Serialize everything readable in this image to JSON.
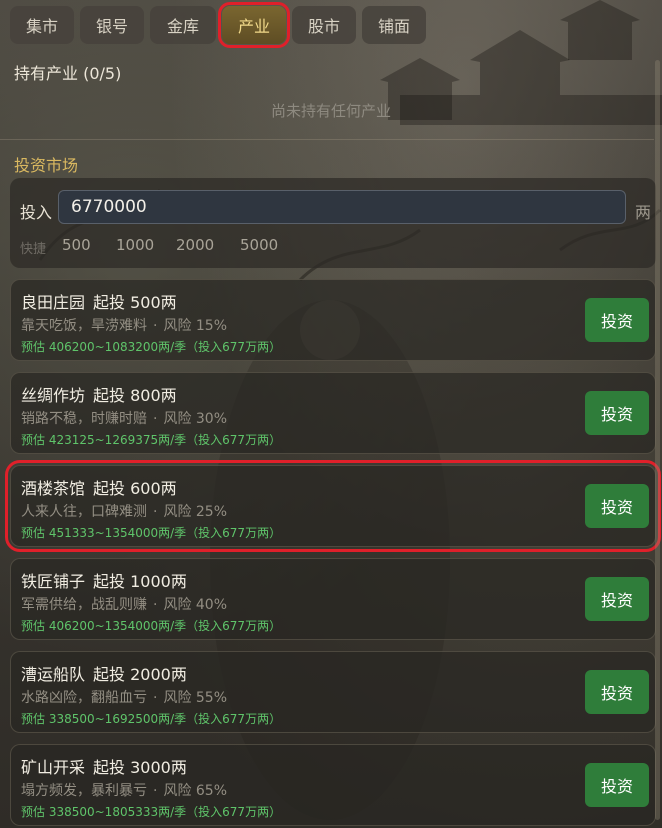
{
  "tabs": [
    {
      "label": "集市"
    },
    {
      "label": "银号"
    },
    {
      "label": "金库"
    },
    {
      "label": "产业",
      "active": true
    },
    {
      "label": "股市"
    },
    {
      "label": "铺面"
    }
  ],
  "holdings": {
    "title": "持有产业 (0/5)",
    "empty_text": "尚未持有任何产业"
  },
  "market": {
    "title": "投资市场",
    "invest_label": "投入",
    "invest_value": "6770000",
    "unit": "两",
    "quick_label": "快捷",
    "quick_amounts": [
      "500",
      "1000",
      "2000",
      "5000"
    ]
  },
  "industries": [
    {
      "name": "良田庄园",
      "min": "起投 500两",
      "desc": "靠天吃饭，旱涝难料",
      "risk": "风险 15%",
      "estimate": "预估 406200~1083200两/季（投入677万两）",
      "button": "投资"
    },
    {
      "name": "丝绸作坊",
      "min": "起投 800两",
      "desc": "销路不稳，时赚时赔",
      "risk": "风险 30%",
      "estimate": "预估 423125~1269375两/季（投入677万两）",
      "button": "投资"
    },
    {
      "name": "酒楼茶馆",
      "min": "起投 600两",
      "desc": "人来人往，口碑难测",
      "risk": "风险 25%",
      "estimate": "预估 451333~1354000两/季（投入677万两）",
      "button": "投资",
      "highlight": true
    },
    {
      "name": "铁匠铺子",
      "min": "起投 1000两",
      "desc": "军需供给，战乱则赚",
      "risk": "风险 40%",
      "estimate": "预估 406200~1354000两/季（投入677万两）",
      "button": "投资"
    },
    {
      "name": "漕运船队",
      "min": "起投 2000两",
      "desc": "水路凶险，翻船血亏",
      "risk": "风险 55%",
      "estimate": "预估 338500~1692500两/季（投入677万两）",
      "button": "投资"
    },
    {
      "name": "矿山开采",
      "min": "起投 3000两",
      "desc": "塌方频发，暴利暴亏",
      "risk": "风险 65%",
      "estimate": "预估 338500~1805333两/季（投入677万两）",
      "button": "投资"
    }
  ],
  "colors": {
    "accent_gold": "#d9b860",
    "invest_green": "#2f7d3a",
    "estimate_green": "#5fc46a",
    "highlight_red": "#e0202a"
  }
}
